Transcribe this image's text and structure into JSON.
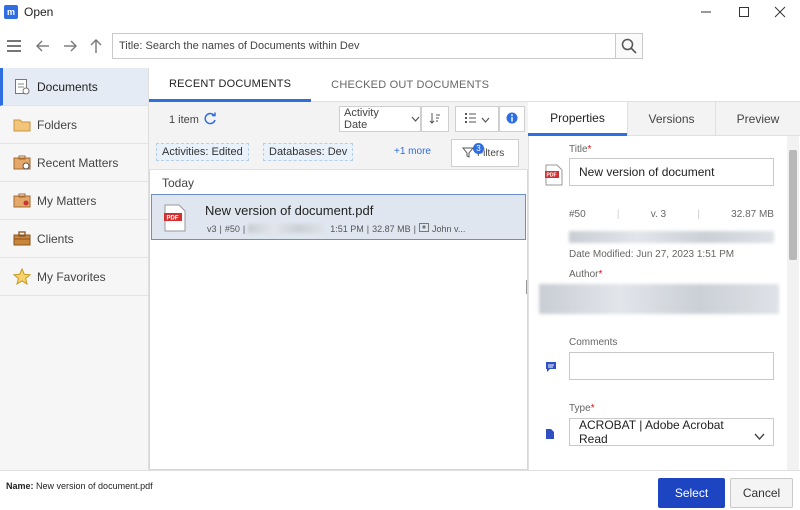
{
  "window": {
    "app_icon": "m",
    "title": "Open",
    "controls": [
      "minimize-icon",
      "maximize-icon",
      "close-icon"
    ]
  },
  "toolbar": {
    "search_value": "Title: Search the names of Documents within Dev",
    "icons": [
      "menu-icon",
      "back-arrow-icon",
      "forward-arrow-icon",
      "up-arrow-icon",
      "search-icon"
    ]
  },
  "sidebar": {
    "items": [
      {
        "label": "Documents",
        "icon": "documents-icon",
        "active": true
      },
      {
        "label": "Folders",
        "icon": "folder-icon"
      },
      {
        "label": "Recent Matters",
        "icon": "recent-matters-icon"
      },
      {
        "label": "My Matters",
        "icon": "my-matters-icon"
      },
      {
        "label": "Clients",
        "icon": "clients-icon"
      },
      {
        "label": "My Favorites",
        "icon": "star-icon"
      }
    ]
  },
  "tabs": [
    "RECENT DOCUMENTS",
    "CHECKED OUT DOCUMENTS"
  ],
  "list": {
    "count": "1 item",
    "sort_by": "Activity Date",
    "filters": [
      "Activities: Edited",
      "Databases: Dev"
    ],
    "more": "+1 more",
    "filters_label": "Filters",
    "filter_count": "3",
    "group": "Today",
    "row": {
      "title": "New version of document.pdf",
      "version": "v3",
      "number": "#50",
      "time": "1:51 PM",
      "size": "32.87 MB",
      "author": "John v..."
    }
  },
  "props": {
    "tabs": [
      "Properties",
      "Versions",
      "Preview"
    ],
    "title_label": "Title",
    "title_value": "New version of document",
    "number": "#50",
    "version": "v. 3",
    "size": "32.87 MB",
    "date_modified": "Date Modified: Jun 27, 2023 1:51 PM",
    "author_label": "Author",
    "comments_label": "Comments",
    "type_label": "Type",
    "type_value": "ACROBAT | Adobe Acrobat Read"
  },
  "footer": {
    "name_label": "Name:",
    "name_value": "New version of document.pdf",
    "select": "Select",
    "cancel": "Cancel"
  },
  "colors": {
    "accent": "#2f6ee0",
    "primary_button": "#1d45c2",
    "selected_row": "#dfe6f0"
  }
}
